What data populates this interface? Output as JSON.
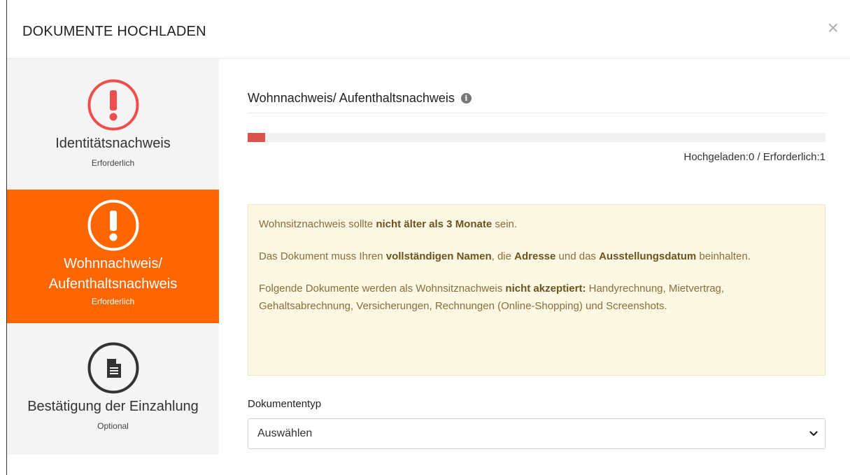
{
  "modal": {
    "title": "DOKUMENTE HOCHLADEN",
    "close_label": "×"
  },
  "steps": [
    {
      "label": "Identitätsnachweis",
      "status": "Erforderlich",
      "icon": "alert-circle-icon",
      "active": false
    },
    {
      "label_line1": "Wohnnachweis/",
      "label_line2": "Aufenthaltsnachweis",
      "status": "Erforderlich",
      "icon": "alert-circle-icon",
      "active": true
    },
    {
      "label": "Bestätigung der Einzahlung",
      "status": "Optional",
      "icon": "document-icon",
      "active": false
    }
  ],
  "section": {
    "title": "Wohnnachweis/ Aufenthaltsnachweis",
    "info_icon": "info-icon"
  },
  "progress": {
    "uploaded": 0,
    "required": 1,
    "text": "Hochgeladen:0 / Erforderlich:1",
    "fill_fraction": 0.03
  },
  "alert": {
    "p1_pre": "Wohnsitznachweis sollte ",
    "p1_bold": "nicht älter als 3 Monate",
    "p1_post": " sein.",
    "p2_pre": "Das Dokument muss Ihren ",
    "p2_bold1": "vollständigen Namen",
    "p2_mid1": ", die ",
    "p2_bold2": "Adresse",
    "p2_mid2": " und das ",
    "p2_bold3": "Ausstellungsdatum",
    "p2_post": " beinhalten.",
    "p3_pre": "Folgende Dokumente werden als Wohnsitznachweis ",
    "p3_bold": "nicht akzeptiert:",
    "p3_post": " Handyrechnung, Mietvertrag, Gehaltsabrechnung, Versicherungen, Rechnungen (Online-Shopping) und Screenshots."
  },
  "document_type": {
    "label": "Dokumententyp",
    "selected": "Auswählen"
  },
  "colors": {
    "active_step": "#ff6600",
    "alert_red": "#f04e4e",
    "progress_fill": "#d9534f",
    "alert_bg": "#fcf8e3"
  }
}
